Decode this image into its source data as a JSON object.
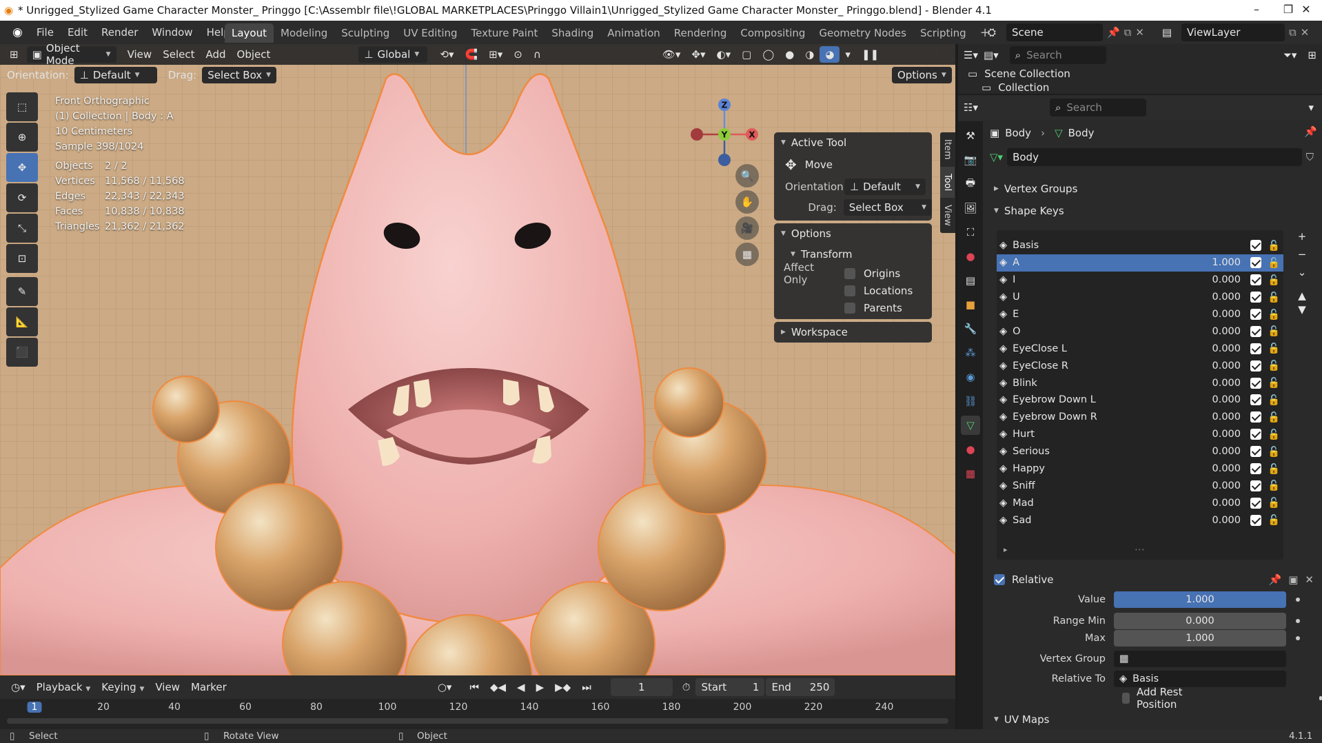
{
  "titlebar": {
    "title": "* Unrigged_Stylized Game Character Monster_ Pringgo [C:\\Assemblr file\\!GLOBAL MARKETPLACES\\Pringgo Villain1\\Unrigged_Stylized Game Character Monster_ Pringgo.blend] - Blender 4.1",
    "minimize": "–",
    "maximize": "❐",
    "close": "✕"
  },
  "menu": [
    "File",
    "Edit",
    "Render",
    "Window",
    "Help"
  ],
  "workspaces": [
    "Layout",
    "Modeling",
    "Sculpting",
    "UV Editing",
    "Texture Paint",
    "Shading",
    "Animation",
    "Rendering",
    "Compositing",
    "Geometry Nodes",
    "Scripting"
  ],
  "scene_label": "Scene",
  "viewlayer_label": "ViewLayer",
  "viewport": {
    "mode": "Object Mode",
    "header_menus": [
      "View",
      "Select",
      "Add",
      "Object"
    ],
    "transform_orientation": "Global",
    "orientation_label": "Orientation:",
    "orientation_value": "Default",
    "drag_label": "Drag:",
    "drag_value": "Select Box",
    "options": "Options",
    "overlay": {
      "view_name": "Front Orthographic",
      "collection": "(1) Collection | Body : A",
      "scale": "10 Centimeters",
      "sample": "Sample 398/1024",
      "stats": [
        {
          "k": "Objects",
          "v": "2 / 2"
        },
        {
          "k": "Vertices",
          "v": "11,568 / 11,568"
        },
        {
          "k": "Edges",
          "v": "22,343 / 22,343"
        },
        {
          "k": "Faces",
          "v": "10,838 / 10,838"
        },
        {
          "k": "Triangles",
          "v": "21,362 / 21,362"
        }
      ]
    },
    "gizmo": {
      "z": "Z",
      "y": "Y",
      "x": "X"
    },
    "npanel": {
      "active_tool": "Active Tool",
      "tool_name": "Move",
      "orientation_label": "Orientation",
      "orientation_value": "Default",
      "drag_label": "Drag:",
      "drag_value": "Select Box",
      "options": "Options",
      "transform": "Transform",
      "affect_only": "Affect Only",
      "affect_items": [
        "Origins",
        "Locations",
        "Parents"
      ],
      "workspace": "Workspace"
    },
    "side_tabs": [
      "Item",
      "Tool",
      "View"
    ]
  },
  "timeline": {
    "menus": [
      "Playback",
      "Keying",
      "View",
      "Marker"
    ],
    "current_frame": "1",
    "start_label": "Start",
    "start": "1",
    "end_label": "End",
    "end": "250",
    "ruler": [
      "1",
      "20",
      "40",
      "60",
      "80",
      "100",
      "120",
      "140",
      "160",
      "180",
      "200",
      "220",
      "240"
    ]
  },
  "statusbar": {
    "select": "Select",
    "rotate": "Rotate View",
    "object": "Object",
    "version": "4.1.1"
  },
  "outliner": {
    "search_placeholder": "Search",
    "scene_collection": "Scene Collection",
    "collection": "Collection"
  },
  "properties": {
    "search_placeholder": "Search",
    "breadcrumb_obj": "Body",
    "breadcrumb_data": "Body",
    "datablock": "Body",
    "vertex_groups": "Vertex Groups",
    "shape_keys": "Shape Keys",
    "keys": [
      {
        "name": "Basis",
        "value": ""
      },
      {
        "name": "A",
        "value": "1.000"
      },
      {
        "name": "I",
        "value": "0.000"
      },
      {
        "name": "U",
        "value": "0.000"
      },
      {
        "name": "E",
        "value": "0.000"
      },
      {
        "name": "O",
        "value": "0.000"
      },
      {
        "name": "EyeClose L",
        "value": "0.000"
      },
      {
        "name": "EyeClose R",
        "value": "0.000"
      },
      {
        "name": "Blink",
        "value": "0.000"
      },
      {
        "name": "Eyebrow Down L",
        "value": "0.000"
      },
      {
        "name": "Eyebrow Down R",
        "value": "0.000"
      },
      {
        "name": "Hurt",
        "value": "0.000"
      },
      {
        "name": "Serious",
        "value": "0.000"
      },
      {
        "name": "Happy",
        "value": "0.000"
      },
      {
        "name": "Sniff",
        "value": "0.000"
      },
      {
        "name": "Mad",
        "value": "0.000"
      },
      {
        "name": "Sad",
        "value": "0.000"
      }
    ],
    "selected_key": 1,
    "relative_label": "Relative",
    "value_label": "Value",
    "value": "1.000",
    "value_fraction": 1.0,
    "range_min_label": "Range Min",
    "range_min": "0.000",
    "max_label": "Max",
    "max": "1.000",
    "vertex_group_label": "Vertex Group",
    "relative_to_label": "Relative To",
    "relative_to": "Basis",
    "add_rest_position": "Add Rest Position",
    "uv_maps": "UV Maps"
  },
  "colors": {
    "accent": "#4772b3",
    "viewport_bg": "#cbaa85",
    "skin": "#f2b7b7",
    "bead": "#d9a46a"
  }
}
